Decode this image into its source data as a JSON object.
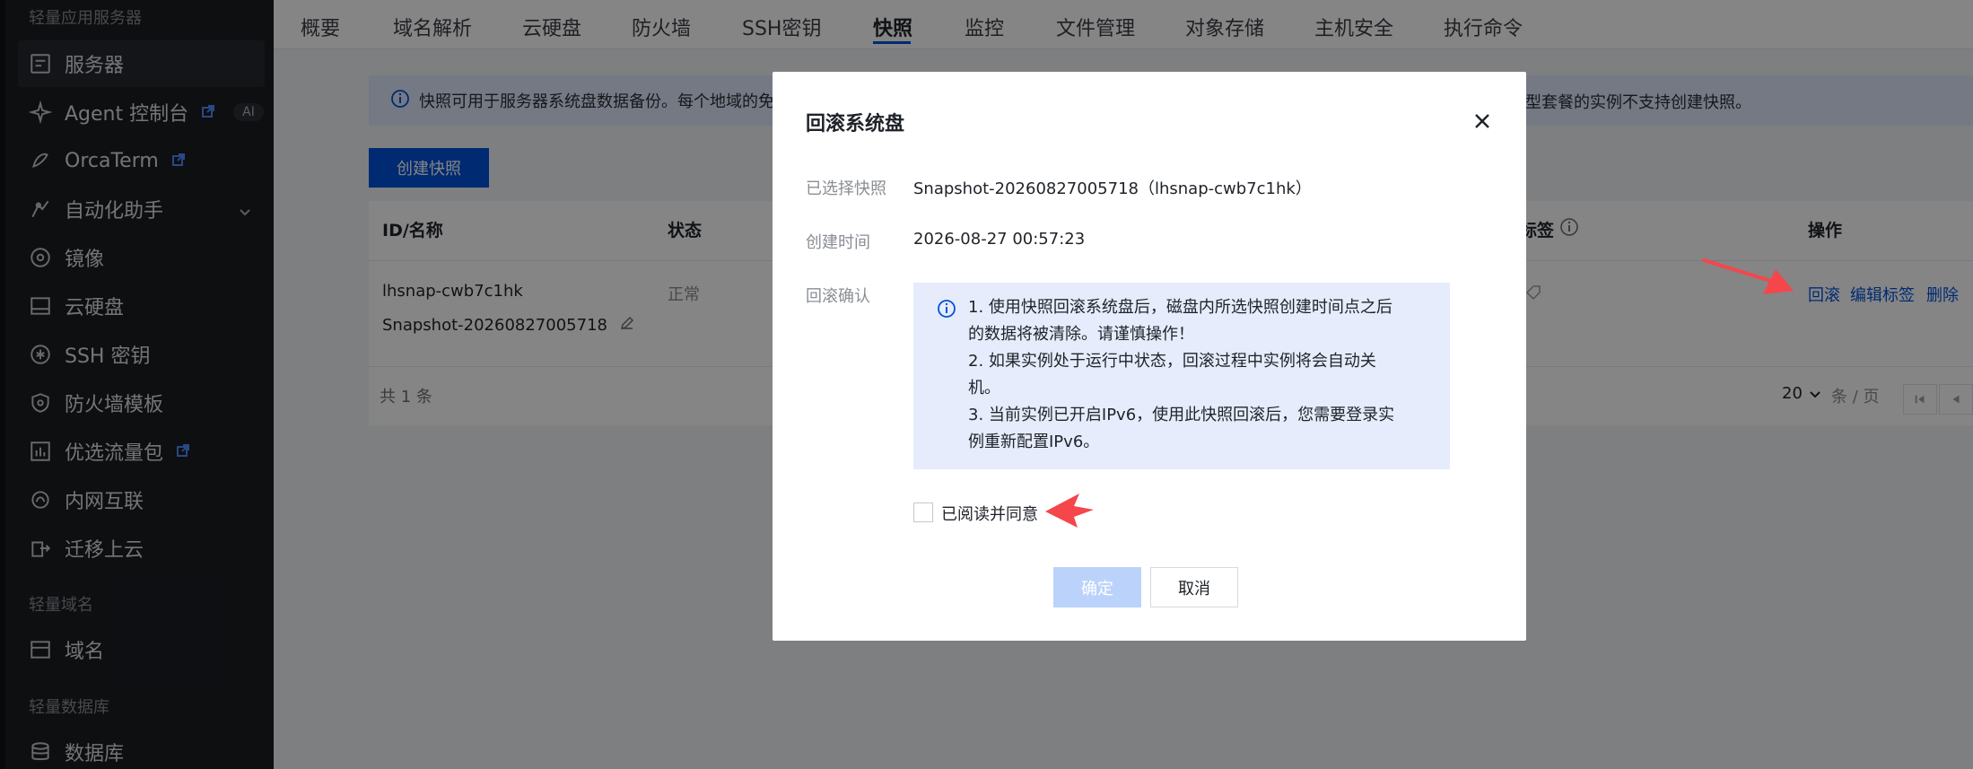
{
  "sidebar": {
    "section_top": "轻量应用服务器",
    "items": [
      {
        "label": "服务器",
        "icon": "server-icon"
      },
      {
        "label": "Agent 控制台",
        "icon": "agent-sparkle-icon",
        "badge": "AI",
        "external": true
      },
      {
        "label": "OrcaTerm",
        "icon": "terminal-icon",
        "external": true
      },
      {
        "label": "自动化助手",
        "icon": "automation-icon",
        "expandable": true
      },
      {
        "label": "镜像",
        "icon": "image-disc-icon"
      },
      {
        "label": "云硬盘",
        "icon": "disk-icon"
      },
      {
        "label": "SSH 密钥",
        "icon": "key-icon"
      },
      {
        "label": "防火墙模板",
        "icon": "shield-icon"
      },
      {
        "label": "优选流量包",
        "icon": "traffic-chart-icon",
        "external": true
      },
      {
        "label": "内网互联",
        "icon": "network-icon"
      },
      {
        "label": "迁移上云",
        "icon": "migrate-icon"
      }
    ],
    "section_domain": "轻量域名",
    "domain_items": [
      {
        "label": "域名",
        "icon": "domain-icon"
      }
    ],
    "section_db": "轻量数据库",
    "db_items": [
      {
        "label": "数据库",
        "icon": "database-icon"
      }
    ]
  },
  "tabs": {
    "items": [
      "概要",
      "域名解析",
      "云硬盘",
      "防火墙",
      "SSH密钥",
      "快照",
      "监控",
      "文件管理",
      "对象存储",
      "主机安全",
      "执行命令"
    ],
    "active": "快照"
  },
  "info": {
    "text_left": "快照可用于服务器系统盘数据备份。每个地域的免",
    "text_right": "型套餐的实例不支持创建快照。"
  },
  "create_button": "创建快照",
  "table": {
    "headers": {
      "id_name": "ID/名称",
      "status": "状态",
      "tags": "标签",
      "actions": "操作"
    },
    "row": {
      "id": "lhsnap-cwb7c1hk",
      "name": "Snapshot-20260827005718",
      "status": "正常",
      "actions": [
        "回滚",
        "编辑标签",
        "删除"
      ]
    },
    "total": "共 1 条",
    "page_size": "20",
    "page_size_unit": "条 / 页"
  },
  "modal": {
    "title": "回滚系统盘",
    "selected_label": "已选择快照",
    "selected_value": "Snapshot-20260827005718（lhsnap-cwb7c1hk）",
    "created_label": "创建时间",
    "created_value": "2026-08-27 00:57:23",
    "confirm_label": "回滚确认",
    "notice_lines": [
      "1. 使用快照回滚系统盘后，磁盘内所选快照创建时间点之后",
      "的数据将被清除。请谨慎操作！",
      "2. 如果实例处于运行中状态，回滚过程中实例将会自动关",
      "机。",
      "3. 当前实例已开启IPv6，使用此快照回滚后，您需要登录实",
      "例重新配置IPv6。"
    ],
    "agree_label": "已阅读并同意",
    "agree_checked": false,
    "ok_label": "确定",
    "cancel_label": "取消"
  },
  "colors": {
    "brand": "#0052d9",
    "sidebar_bg": "#1b1d22",
    "annotation_arrow": "#f5464b",
    "disabled_button": "#bbd3fb"
  }
}
